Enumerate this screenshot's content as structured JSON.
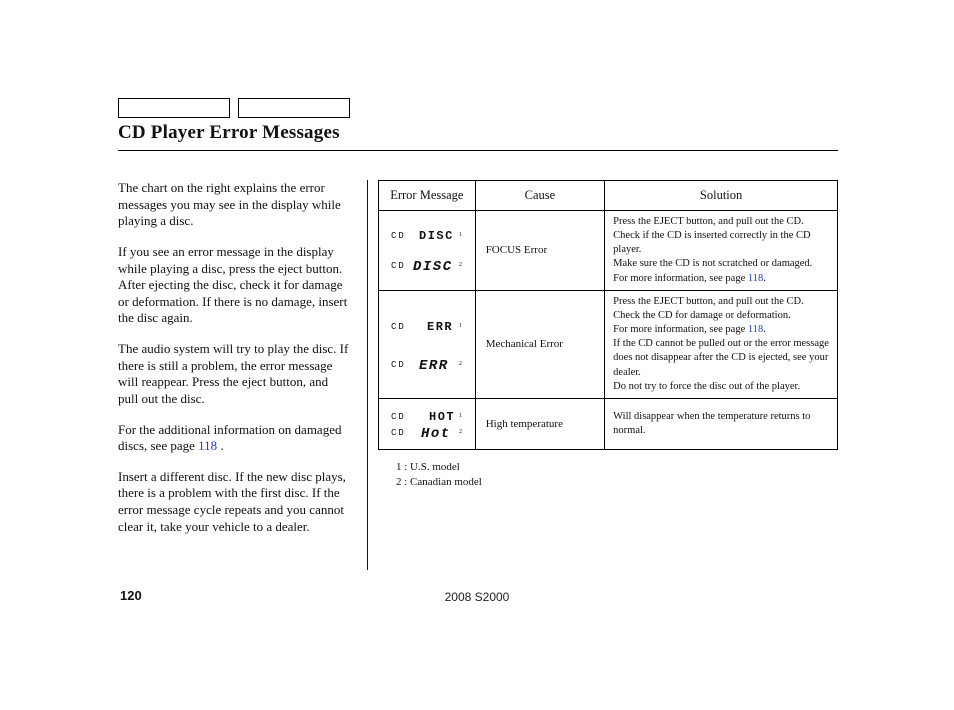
{
  "title": "CD Player Error Messages",
  "paragraphs": {
    "p1": "The chart on the right explains the error messages you may see in the display while playing a disc.",
    "p2": "If you see an error message in the display while playing a disc, press the eject button. After ejecting the disc, check it for damage or deformation. If there is no damage, insert the disc again.",
    "p3": "The audio system will try to play the disc. If there is still a problem, the error message will reappear. Press the eject button, and pull out the disc.",
    "p4a": "For the additional information on damaged discs, see page ",
    "p4link": "118",
    "p4b": " .",
    "p5": "Insert a different disc. If the new disc plays, there is a problem with the first disc. If the error message cycle repeats and you cannot clear it, take your vehicle to a dealer."
  },
  "table": {
    "headers": {
      "msg": "Error Message",
      "cause": "Cause",
      "sol": "Solution"
    },
    "rows": {
      "r1": {
        "cause": "FOCUS Error",
        "sol_a": "Press the EJECT button, and pull out the CD. Check if the CD is inserted correctly in the CD player.",
        "sol_b": "Make sure the CD is not scratched or damaged.",
        "sol_c1": "For more information, see page ",
        "sol_c_link": "118",
        "sol_c2": "."
      },
      "r2": {
        "cause": "Mechanical Error",
        "sol_a": "Press the EJECT button, and pull out the CD. Check the CD for damage or deformation.",
        "sol_b1": "For more information, see page ",
        "sol_b_link": "118",
        "sol_b2": ".",
        "sol_c": "If the CD cannot be pulled out or the error message does not disappear after the CD is ejected, see your dealer.",
        "sol_d": "Do not try to force the disc out of the player."
      },
      "r3": {
        "cause": "High temperature",
        "sol": "Will disappear when the temperature returns to normal."
      }
    }
  },
  "footnotes": {
    "f1": "1 : U.S. model",
    "f2": "2 : Canadian model"
  },
  "page_number": "120",
  "footer": "2008  S2000",
  "display_labels": {
    "cd": "CD",
    "disc1": "DISC",
    "disc2": "DISC",
    "err1": "ERR",
    "err2": "ERR",
    "hot1": "HOT",
    "hot2": "Hot",
    "n1": "1",
    "n2": "2"
  }
}
